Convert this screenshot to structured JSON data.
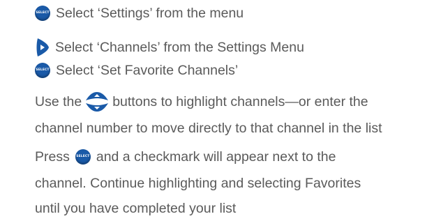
{
  "steps": {
    "step1": {
      "text": "Select ‘Settings’ from the menu",
      "icon": "select-button-icon",
      "icon_label": "SELECT"
    },
    "step2": {
      "text": "Select ‘Channels’ from the Settings Menu",
      "icon": "right-arrow-button-icon"
    },
    "step3": {
      "text": "Select ‘Set Favorite Channels’",
      "icon": "select-button-icon",
      "icon_label": "SELECT"
    },
    "step4": {
      "before": "Use the",
      "icon": "up-down-arrows-icon",
      "after": "buttons to highlight channels—or enter the",
      "line2": "channel number to move directly to that channel in the list"
    },
    "step5": {
      "before": "Press",
      "icon": "select-button-icon",
      "icon_label": "SELECT",
      "after": "and a checkmark will appear next to the",
      "line2": "channel. Continue highlighting and selecting Favorites",
      "line3": "until you have completed your list"
    }
  },
  "colors": {
    "text": "#5a5a5a",
    "button_blue": "#1a5aa8"
  }
}
